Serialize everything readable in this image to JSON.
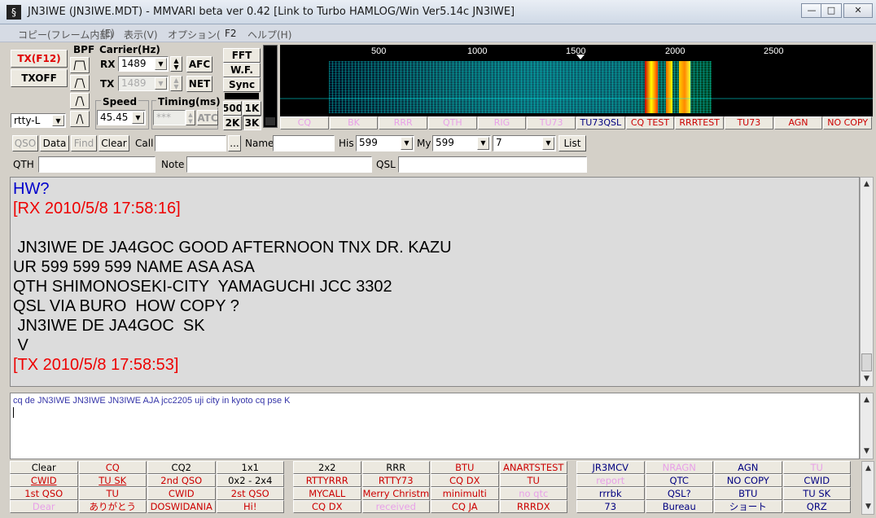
{
  "window": {
    "title": "JN3IWE (JN3IWE.MDT) - MMVARI beta ver 0.42 [Link to Turbo HAMLOG/Win Ver5.14c JN3IWE]",
    "minimize": "—",
    "maximize": "□",
    "close": "✕"
  },
  "menu": [
    "コピー(フレーム内部)",
    "(E)",
    "表示(V)",
    "オプション(",
    "F2",
    "ヘルプ(H)"
  ],
  "controls": {
    "tx_label": "TX(F12)",
    "txoff_label": "TXOFF",
    "bpf_label": "BPF",
    "carrier_label": "Carrier(Hz)",
    "rx_label": "RX",
    "rx_value": "1489",
    "tx_freq_label": "TX",
    "tx_value": "1489",
    "afc_label": "AFC",
    "net_label": "NET",
    "speed_label": "Speed",
    "speed_value": "45.45",
    "timing_label": "Timing(ms)",
    "timing_value": "***",
    "atc_label": "ATC",
    "mode_value": "rtty-L",
    "fft_label": "FFT",
    "wf_label": "W.F.",
    "sync_label": "Sync",
    "bw500": "500",
    "bw1k": "1K",
    "bw2k": "2K",
    "bw3k": "3K"
  },
  "scale_ticks": [
    "500",
    "1000",
    "1500",
    "2000",
    "2500"
  ],
  "macro_row1": [
    {
      "label": "CQ",
      "color": "#e8a0e8"
    },
    {
      "label": "BK",
      "color": "#e8a0e8"
    },
    {
      "label": "RRR",
      "color": "#e8a0e8"
    },
    {
      "label": "QTH",
      "color": "#e8a0e8"
    },
    {
      "label": "RIG",
      "color": "#e8a0e8"
    },
    {
      "label": "TU73",
      "color": "#e8a0e8"
    },
    {
      "label": "TU73QSL",
      "color": "#000080"
    },
    {
      "label": "CQ TEST",
      "color": "#cc0000"
    },
    {
      "label": "RRRTEST",
      "color": "#cc0000"
    },
    {
      "label": "TU73",
      "color": "#cc0000"
    },
    {
      "label": "AGN",
      "color": "#cc0000"
    },
    {
      "label": "NO COPY",
      "color": "#cc0000"
    }
  ],
  "logbar": {
    "qso": "QSO",
    "data": "Data",
    "find": "Find",
    "clear": "Clear",
    "call_label": "Call",
    "call_value": "",
    "more": "...",
    "name_label": "Name",
    "name_value": "",
    "his_label": "His",
    "his_value": "599",
    "my_label": "My",
    "my_value": "599",
    "band_value": "7",
    "list": "List",
    "qth_label": "QTH",
    "qth_value": "",
    "note_label": "Note",
    "note_value": "",
    "qsl_label": "QSL",
    "qsl_value": ""
  },
  "rx_lines": [
    {
      "text": "HW?",
      "color": "#0000cc"
    },
    {
      "text": "[RX 2010/5/8 17:58:16]",
      "color": "#ee0000"
    },
    {
      "text": "",
      "color": "#000000"
    },
    {
      "text": " JN3IWE DE JA4GOC GOOD AFTERNOON TNX DR. KAZU",
      "color": "#000000"
    },
    {
      "text": "UR 599 599 599 NAME ASA ASA",
      "color": "#000000"
    },
    {
      "text": "QTH SHIMONOSEKI-CITY  YAMAGUCHI JCC 3302",
      "color": "#000000"
    },
    {
      "text": "QSL VIA BURO  HOW COPY ?",
      "color": "#000000"
    },
    {
      "text": " JN3IWE DE JA4GOC  SK",
      "color": "#000000"
    },
    {
      "text": " V",
      "color": "#000000"
    },
    {
      "text": "[TX 2010/5/8 17:58:53]",
      "color": "#ee0000"
    }
  ],
  "tx_text": "cq de JN3IWE JN3IWE JN3IWE AJA jcc2205 uji city in kyoto cq pse K",
  "macro_grid": [
    [
      {
        "label": "Clear",
        "color": "#000000"
      },
      {
        "label": "CQ",
        "color": "#cc0000"
      },
      {
        "label": "CQ2",
        "color": "#000000"
      },
      {
        "label": "1x1",
        "color": "#000000"
      },
      {
        "label": "2x2",
        "color": "#000000"
      },
      {
        "label": "RRR",
        "color": "#000000"
      },
      {
        "label": "BTU",
        "color": "#cc0000"
      },
      {
        "label": "ANARTSTEST",
        "color": "#cc0000"
      },
      {
        "label": "JR3MCV",
        "color": "#000080"
      },
      {
        "label": "NRAGN",
        "color": "#e8a0e8"
      },
      {
        "label": "AGN",
        "color": "#000080"
      },
      {
        "label": "TU",
        "color": "#e8a0e8"
      }
    ],
    [
      {
        "label": "CWID",
        "color": "#cc0000"
      },
      {
        "label": "TU SK",
        "color": "#cc0000"
      },
      {
        "label": "2nd QSO",
        "color": "#cc0000"
      },
      {
        "label": "0x2 - 2x4",
        "color": "#000000"
      },
      {
        "label": "RTTYRRR",
        "color": "#cc0000"
      },
      {
        "label": "RTTY73",
        "color": "#cc0000"
      },
      {
        "label": "CQ DX",
        "color": "#cc0000"
      },
      {
        "label": "TU",
        "color": "#cc0000"
      },
      {
        "label": "report",
        "color": "#e8a0e8"
      },
      {
        "label": "QTC",
        "color": "#000080"
      },
      {
        "label": "NO COPY",
        "color": "#000080"
      },
      {
        "label": "CWID",
        "color": "#000080"
      }
    ],
    [
      {
        "label": "1st QSO",
        "color": "#cc0000"
      },
      {
        "label": "TU",
        "color": "#cc0000"
      },
      {
        "label": "CWID",
        "color": "#cc0000"
      },
      {
        "label": "2st QSO",
        "color": "#cc0000"
      },
      {
        "label": "MYCALL",
        "color": "#cc0000"
      },
      {
        "label": "Merry Christmas",
        "color": "#cc0000"
      },
      {
        "label": "minimulti",
        "color": "#cc0000"
      },
      {
        "label": "no qtc",
        "color": "#e8a0e8"
      },
      {
        "label": "rrrbk",
        "color": "#000080"
      },
      {
        "label": "QSL?",
        "color": "#000080"
      },
      {
        "label": "BTU",
        "color": "#000080"
      },
      {
        "label": "TU SK",
        "color": "#000080"
      }
    ],
    [
      {
        "label": "Dear",
        "color": "#e8a0e8"
      },
      {
        "label": "ありがとう",
        "color": "#cc0000"
      },
      {
        "label": "DOSWIDANIA",
        "color": "#cc0000"
      },
      {
        "label": "Hi!",
        "color": "#cc0000"
      },
      {
        "label": "CQ DX",
        "color": "#cc0000"
      },
      {
        "label": "received",
        "color": "#e8a0e8"
      },
      {
        "label": "CQ JA",
        "color": "#cc0000"
      },
      {
        "label": "RRRDX",
        "color": "#cc0000"
      },
      {
        "label": "73",
        "color": "#000080"
      },
      {
        "label": "Bureau",
        "color": "#000080"
      },
      {
        "label": "ショート",
        "color": "#000080"
      },
      {
        "label": "QRZ",
        "color": "#000080"
      }
    ]
  ]
}
